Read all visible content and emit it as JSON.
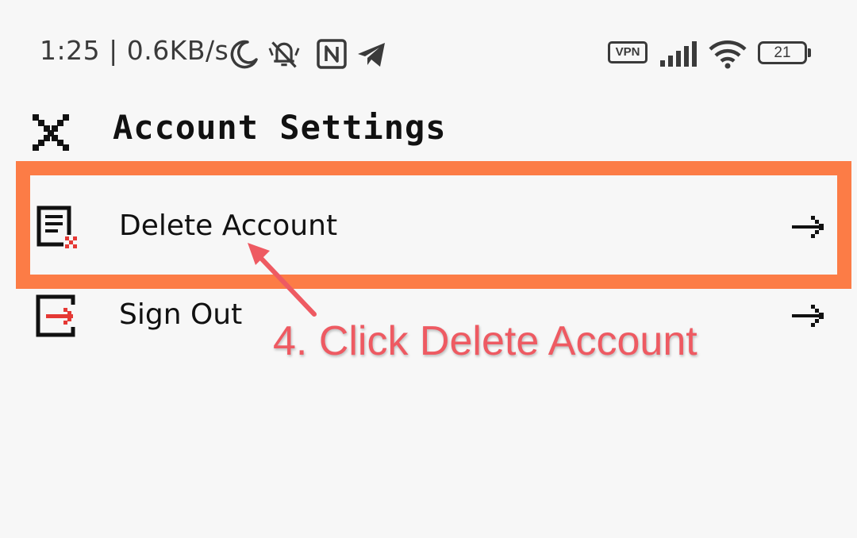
{
  "status_bar": {
    "time_speed": "1:25 | 0.6KB/s",
    "vpn_label": "VPN",
    "battery_level": "21",
    "icons": [
      "moon-icon",
      "mute-vibrate-icon",
      "nfc-icon",
      "telegram-icon",
      "signal-icon",
      "wifi-icon",
      "battery-icon"
    ]
  },
  "header": {
    "close_icon": "close-icon",
    "title": "Account Settings"
  },
  "rows": [
    {
      "icon": "delete-document-icon",
      "label": "Delete Account",
      "arrow_icon": "arrow-right-icon"
    },
    {
      "icon": "sign-out-icon",
      "label": "Sign Out",
      "arrow_icon": "arrow-right-icon"
    }
  ],
  "annotation": {
    "text": "4. Click Delete Account",
    "box_color": "#fc7c46",
    "text_color": "#ee5a62"
  },
  "colors": {
    "background": "#f7f7f7",
    "accent_red": "#e53935",
    "text": "#111111"
  }
}
